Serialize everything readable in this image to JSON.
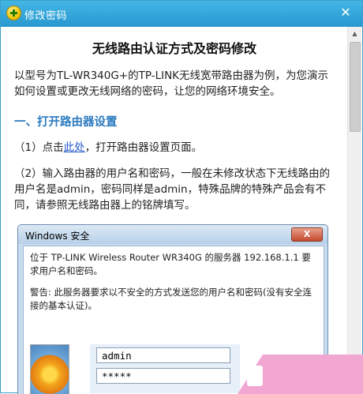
{
  "window": {
    "title": "修改密码",
    "close_glyph": "✕",
    "title_icon": "plus-circle-icon"
  },
  "article": {
    "heading": "无线路由认证方式及密码修改",
    "intro": "以型号为TL-WR340G+的TP-LINK无线宽带路由器为例，为您演示如何设置或更改无线网络的密码，让您的网络环境安全。",
    "section_title": "一、打开路由器设置",
    "step1_prefix": "（1）点击",
    "step1_link": "此处",
    "step1_suffix": "，打开路由器设置页面。",
    "step2": "（2）输入路由器的用户名和密码，一般在未修改状态下无线路由的用户名是admin，密码同样是admin，特殊品牌的特殊产品会有不同，请参照无线路由器上的铭牌填写。"
  },
  "dialog": {
    "title": "Windows 安全",
    "close_glyph": "X",
    "message": "位于 TP-LINK Wireless Router WR340G 的服务器 192.168.1.1 要求用户名和密码。",
    "warning": "警告: 此服务器要求以不安全的方式发送您的用户名和密码(没有安全连接的基本认证)。",
    "username": "admin",
    "password": "*****",
    "user_tile_icon": "user-tile-flower-icon"
  },
  "scrollbar": {
    "up_glyph": "▲",
    "down_glyph": "▼"
  },
  "colors": {
    "titlebar": "#2fa3d9",
    "section": "#2c7bbf",
    "link": "#2255cc"
  }
}
